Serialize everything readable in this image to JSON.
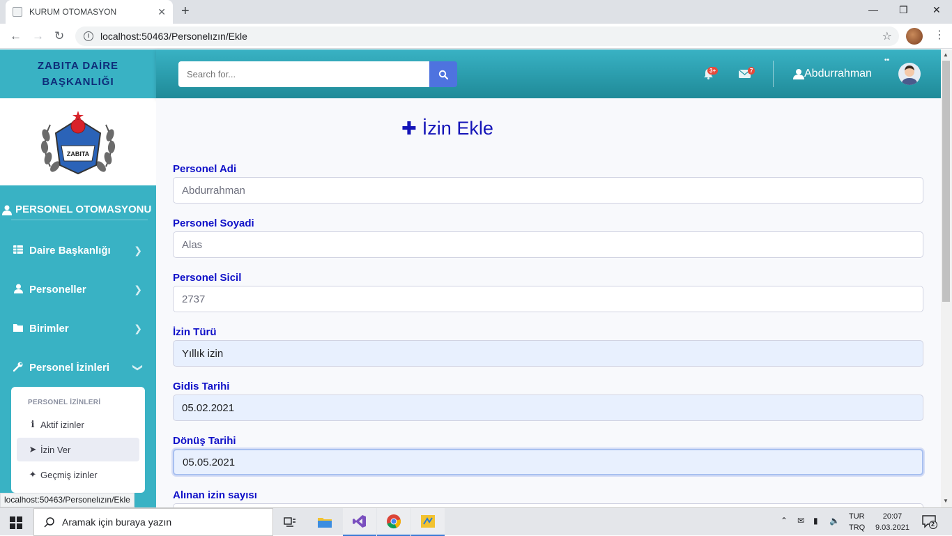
{
  "browser": {
    "tab_title": "KURUM OTOMASYON",
    "tab_close": "✕",
    "new_tab": "+",
    "url": "localhost:50463/Personelızın/Ekle",
    "status_url": "localhost:50463/Personelızın/Ekle"
  },
  "sidebar": {
    "brand_line1": "ZABITA DAİRE",
    "brand_line2": "BAŞKANLIĞI",
    "logo_text": "ZABITA",
    "heading": "PERSONEL OTOMASYONU",
    "items": [
      {
        "label": "Daire Başkanlığı",
        "icon": "table-icon"
      },
      {
        "label": "Personeller",
        "icon": "user-icon"
      },
      {
        "label": "Birimler",
        "icon": "folder-icon"
      },
      {
        "label": "Personel İzinleri",
        "icon": "wrench-icon"
      }
    ],
    "submenu": {
      "heading": "PERSONEL İZİNLERİ",
      "items": [
        {
          "label": "Aktif izinler",
          "icon": "info-icon"
        },
        {
          "label": "İzin Ver",
          "icon": "arrow-right-icon"
        },
        {
          "label": "Geçmiş izinler",
          "icon": "sparkle-icon"
        }
      ]
    }
  },
  "topbar": {
    "search_placeholder": "Search for...",
    "alerts_badge": "3+",
    "messages_badge": "7",
    "username": "Abdurrahman"
  },
  "form": {
    "title": "İzin Ekle",
    "fields": [
      {
        "label": "Personel Adi",
        "value": "Abdurrahman"
      },
      {
        "label": "Personel Soyadi",
        "value": "Alas"
      },
      {
        "label": "Personel Sicil",
        "value": "2737"
      },
      {
        "label": "İzin Türü",
        "value": "Yıllık izin"
      },
      {
        "label": "Gidis Tarihi",
        "value": "05.02.2021"
      },
      {
        "label": "Dönüş Tarihi",
        "value": "05.05.2021"
      },
      {
        "label": "Alınan izin sayısı",
        "value": ""
      }
    ]
  },
  "taskbar": {
    "search_placeholder": "Aramak için buraya yazın",
    "lang_line1": "TUR",
    "lang_line2": "TRQ",
    "time": "20:07",
    "date": "9.03.2021",
    "notification_count": "2"
  },
  "colors": {
    "sidebar": "#39b2c4",
    "label": "#0f10c8",
    "brand": "#0e2d7a",
    "search_button": "#4e73df"
  }
}
